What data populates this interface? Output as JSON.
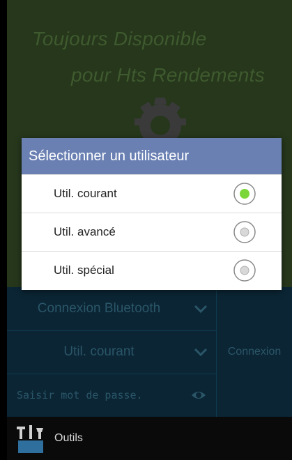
{
  "splash": {
    "tagline_line1": "Toujours Disponible",
    "tagline_line2": "pour Hts Rendements",
    "logo_icon": "gear-icon"
  },
  "connection": {
    "mode_select": {
      "value": "Connexion Bluetooth",
      "icon": "chevron-down-icon"
    },
    "user_select": {
      "value": "Util. courant",
      "icon": "chevron-down-icon"
    },
    "password_input": {
      "placeholder": "Saisir mot de passe.",
      "value": "",
      "icon": "eye-icon"
    },
    "connect_button": "Connexion"
  },
  "toolbar": {
    "tools_label": "Outils",
    "tools_icon": "tools-icon"
  },
  "dialog": {
    "title": "Sélectionner un utilisateur",
    "options": [
      {
        "label": "Util. courant",
        "selected": true
      },
      {
        "label": "Util. avancé",
        "selected": false
      },
      {
        "label": "Util. spécial",
        "selected": false
      }
    ]
  },
  "colors": {
    "dialog_header": "#6a80b3",
    "radio_selected": "#7bd63a",
    "splash_bg": "#26371c",
    "panel_bg": "#0b2534"
  }
}
